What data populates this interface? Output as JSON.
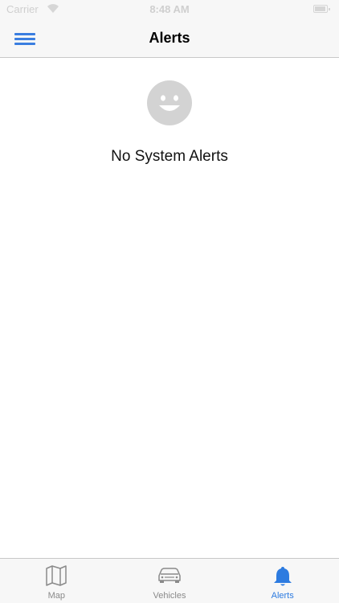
{
  "status_bar": {
    "carrier": "Carrier",
    "time": "8:48 AM"
  },
  "nav": {
    "title": "Alerts",
    "menu_icon": "hamburger-menu-icon"
  },
  "empty_state": {
    "icon": "smiley-icon",
    "message": "No System Alerts"
  },
  "tabs": [
    {
      "label": "Map",
      "icon": "map-icon",
      "active": false
    },
    {
      "label": "Vehicles",
      "icon": "car-icon",
      "active": false
    },
    {
      "label": "Alerts",
      "icon": "bell-icon",
      "active": true
    }
  ],
  "colors": {
    "accent": "#2d7be0",
    "inactive": "#8a8a8a",
    "bar_background": "#f7f7f7",
    "smiley": "#d3d3d3"
  }
}
